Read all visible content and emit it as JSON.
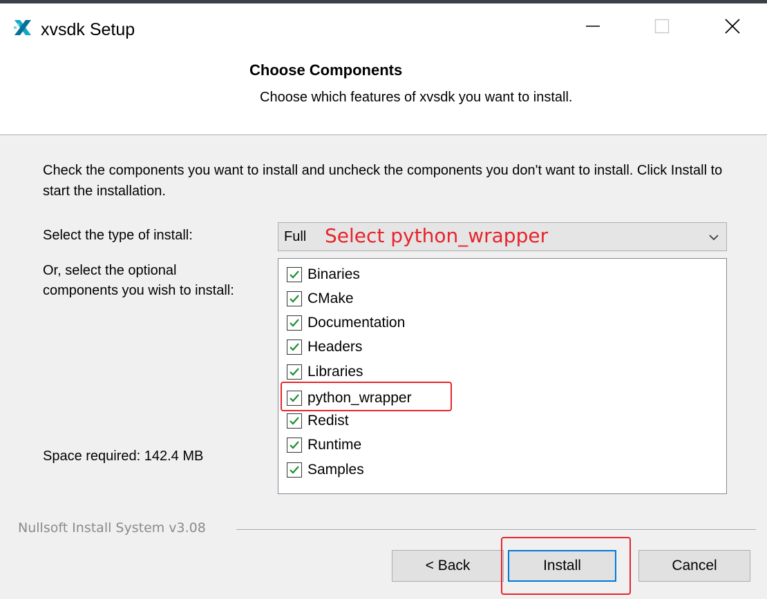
{
  "window": {
    "title": "xvsdk Setup",
    "icons": {
      "app": "xvsdk-logo-icon",
      "minimize": "minimize-icon",
      "maximize": "maximize-icon",
      "close": "close-icon"
    }
  },
  "header": {
    "title": "Choose Components",
    "subtitle": "Choose which features of xvsdk you want to install."
  },
  "body": {
    "instructions": "Check the components you want to install and uncheck the components you don't want to install. Click Install to start the installation.",
    "install_type_label": "Select the type of install:",
    "install_type_value": "Full",
    "optional_label": "Or, select the optional components you wish to install:",
    "space_required": "Space required: 142.4 MB"
  },
  "components": [
    {
      "label": "Binaries",
      "checked": true
    },
    {
      "label": "CMake",
      "checked": true
    },
    {
      "label": "Documentation",
      "checked": true
    },
    {
      "label": "Headers",
      "checked": true
    },
    {
      "label": "Libraries",
      "checked": true
    },
    {
      "label": "python_wrapper",
      "checked": true
    },
    {
      "label": "Redist",
      "checked": true
    },
    {
      "label": "Runtime",
      "checked": true
    },
    {
      "label": "Samples",
      "checked": true
    }
  ],
  "annotations": {
    "select_hint": "Select python_wrapper",
    "color": "#e8232b"
  },
  "footer": {
    "branding": "Nullsoft Install System v3.08",
    "back_label": "< Back",
    "install_label": "Install",
    "cancel_label": "Cancel"
  },
  "colors": {
    "accent": "#0078d7",
    "checkmark": "#1a8f2e",
    "annotation": "#e8232b"
  }
}
